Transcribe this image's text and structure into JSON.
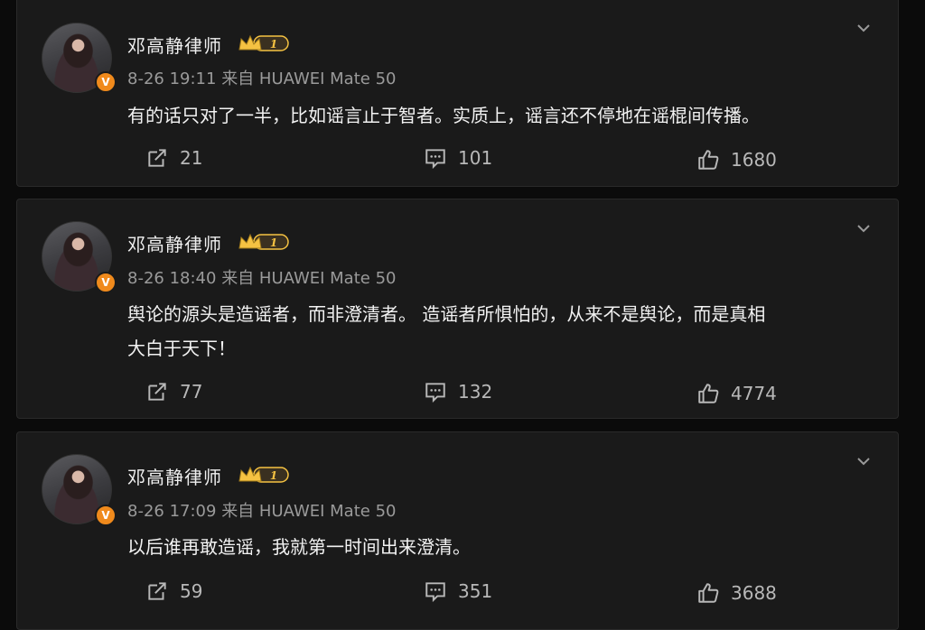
{
  "posts": [
    {
      "author": "邓高静律师",
      "level": "1",
      "verified_mark": "V",
      "time": "8-26 19:11",
      "source": "来自 HUAWEI Mate 50",
      "text_lines": [
        "有的话只对了一半，比如谣言止于智者。实质上，谣言还不停地在谣棍间传播。"
      ],
      "reposts": "21",
      "comments": "101",
      "likes": "1680"
    },
    {
      "author": "邓高静律师",
      "level": "1",
      "verified_mark": "V",
      "time": "8-26 18:40",
      "source": "来自 HUAWEI Mate 50",
      "text_lines": [
        "舆论的源头是造谣者，而非澄清者。 造谣者所惧怕的，从来不是舆论，而是真相",
        "大白于天下！"
      ],
      "reposts": "77",
      "comments": "132",
      "likes": "4774"
    },
    {
      "author": "邓高静律师",
      "level": "1",
      "verified_mark": "V",
      "time": "8-26 17:09",
      "source": "来自 HUAWEI Mate 50",
      "text_lines": [
        "以后谁再敢造谣，我就第一时间出来澄清。"
      ],
      "reposts": "59",
      "comments": "351",
      "likes": "3688"
    }
  ],
  "icons": {
    "repost": "repost-icon",
    "comment": "comment-icon",
    "like": "like-icon",
    "more": "chevron-down-icon",
    "crown": "crown-badge-icon"
  },
  "colors": {
    "background": "#0b0b0b",
    "card": "#1a1a1a",
    "verified": "#f08a1c",
    "crown": "#f5c242"
  }
}
